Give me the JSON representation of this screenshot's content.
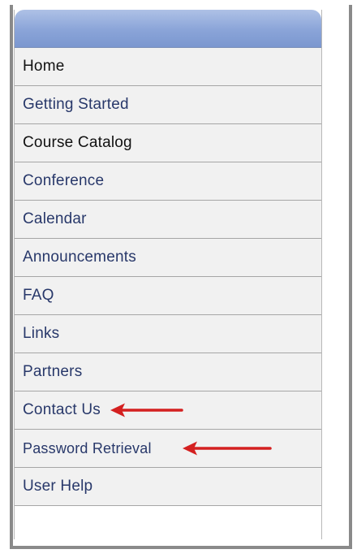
{
  "menu": {
    "items": [
      {
        "label": "Home",
        "color": "#111111"
      },
      {
        "label": "Getting Started",
        "color": "#28386a"
      },
      {
        "label": "Course Catalog",
        "color": "#111111"
      },
      {
        "label": "Conference",
        "color": "#28386a"
      },
      {
        "label": "Calendar",
        "color": "#28386a"
      },
      {
        "label": "Announcements",
        "color": "#28386a"
      },
      {
        "label": "FAQ",
        "color": "#28386a"
      },
      {
        "label": "Links",
        "color": "#28386a"
      },
      {
        "label": "Partners",
        "color": "#28386a"
      },
      {
        "label": "Contact Us",
        "color": "#28386a",
        "annotated": true
      },
      {
        "label": "Password Retrieval",
        "color": "#28386a",
        "annotated": true
      },
      {
        "label": "User Help",
        "color": "#28386a"
      }
    ]
  },
  "colors": {
    "header_gradient_top": "#aec1e6",
    "header_gradient_bottom": "#7b97cf",
    "item_background": "#f1f1f1",
    "item_border": "#a6a6a6",
    "arrow": "#d42020"
  },
  "icons": {
    "annotation_arrow": "red-arrow-left-icon"
  }
}
